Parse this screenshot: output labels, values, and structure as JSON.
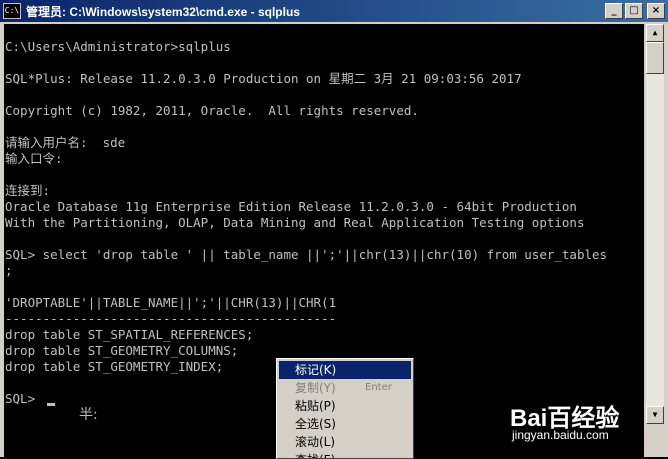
{
  "window": {
    "title": "管理员: C:\\Windows\\system32\\cmd.exe - sqlplus",
    "icon": "C:\\",
    "buttons": {
      "minimize": "_",
      "maximize": "□",
      "close": "×"
    }
  },
  "console": {
    "lines": [
      "C:\\Users\\Administrator>sqlplus",
      "",
      "SQL*Plus: Release 11.2.0.3.0 Production on 星期二 3月 21 09:03:56 2017",
      "",
      "Copyright (c) 1982, 2011, Oracle.  All rights reserved.",
      "",
      "请输入用户名:  sde",
      "输入口令:",
      "",
      "连接到:",
      "Oracle Database 11g Enterprise Edition Release 11.2.0.3.0 - 64bit Production",
      "With the Partitioning, OLAP, Data Mining and Real Application Testing options",
      "",
      "SQL> select 'drop table ' || table_name ||';'||chr(13)||chr(10) from user_tables",
      ";",
      "",
      "'DROPTABLE'||TABLE_NAME||';'||CHR(13)||CHR(1",
      "--------------------------------------------",
      "drop table ST_SPATIAL_REFERENCES;",
      "drop table ST_GEOMETRY_COLUMNS;",
      "drop table ST_GEOMETRY_INDEX;",
      "",
      "SQL> "
    ],
    "ime_indicator": "半:"
  },
  "context_menu": {
    "items": [
      {
        "label": "标记(K)",
        "shortcut": "",
        "state": "selected"
      },
      {
        "label": "复制(Y)",
        "shortcut": "Enter",
        "state": "disabled"
      },
      {
        "label": "粘贴(P)",
        "shortcut": "",
        "state": "normal"
      },
      {
        "label": "全选(S)",
        "shortcut": "",
        "state": "normal"
      },
      {
        "label": "滚动(L)",
        "shortcut": "",
        "state": "normal"
      },
      {
        "label": "查找(F)...",
        "shortcut": "",
        "state": "normal"
      }
    ]
  },
  "watermark": {
    "logo": "Bai百经验",
    "url": "jingyan.baidu.com"
  }
}
